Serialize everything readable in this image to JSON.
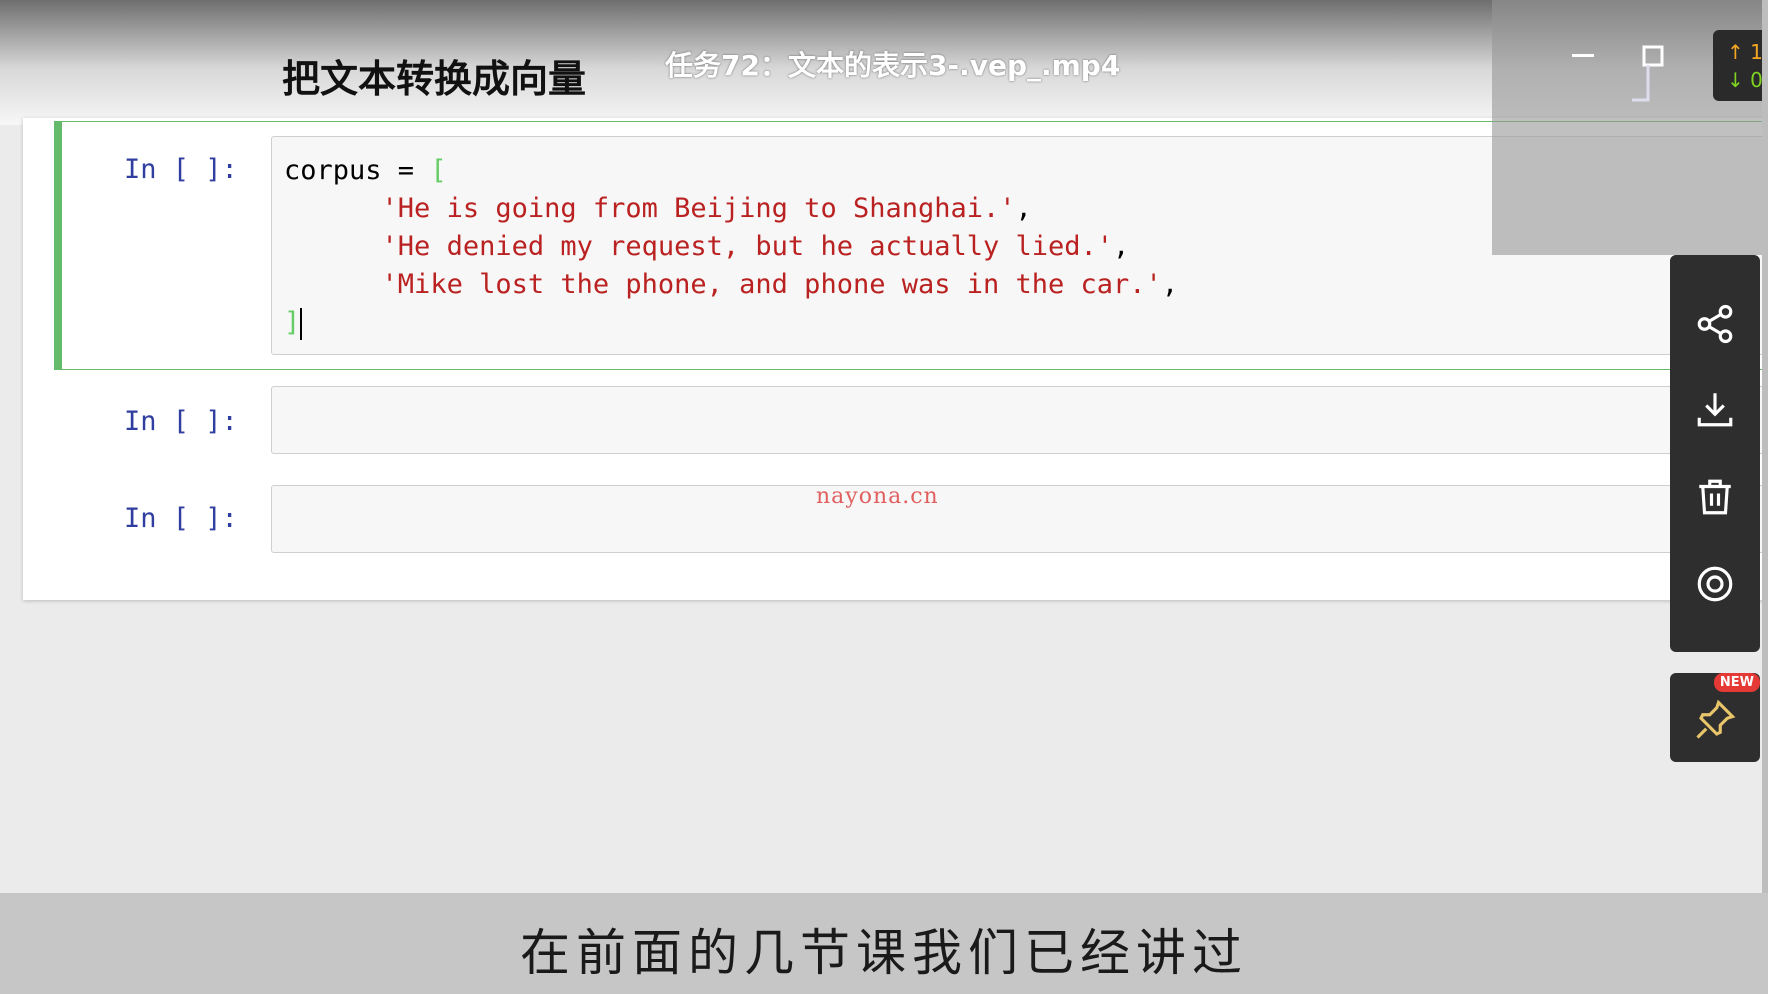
{
  "notebook": {
    "heading": "把文本转换成向量",
    "cells": [
      {
        "prompt": "In [ ]:",
        "code": {
          "line1_var": "corpus = ",
          "open": "[",
          "strings": [
            "'He is going from Beijing to Shanghai.'",
            "'He denied my request, but he actually lied.'",
            "'Mike lost the phone, and phone was in the car.'"
          ],
          "comma": ",",
          "close": "]"
        }
      },
      {
        "prompt": "In [ ]:"
      },
      {
        "prompt": "In [ ]:"
      }
    ]
  },
  "video": {
    "title": "任务72：文本的表示3-.vep_.mp4",
    "watermark": "nayona.cn",
    "subtitle": "在前面的几节课我们已经讲过"
  },
  "speed": {
    "up": "↑ 1.",
    "down": "↓ 0."
  },
  "toolbar": {
    "new_badge": "NEW",
    "icons": [
      "share-icon",
      "download-icon",
      "trash-icon",
      "settings-icon",
      "pin-icon"
    ]
  },
  "colors": {
    "cell_border": "#66bb6a",
    "string": "#ba2121",
    "prompt": "#303f9f",
    "pin": "#e8c46a"
  }
}
